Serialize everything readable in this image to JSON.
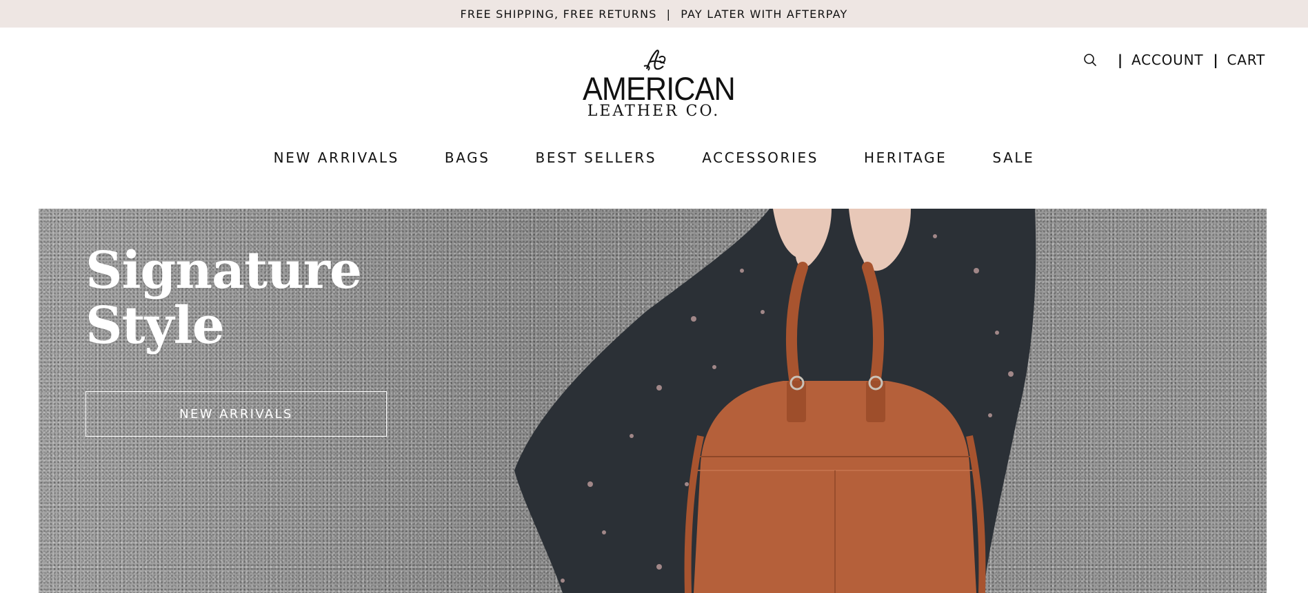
{
  "announcement": {
    "left_text": "FREE SHIPPING, FREE RETURNS",
    "separator": "|",
    "right_text": "PAY LATER WITH AFTERPAY"
  },
  "header": {
    "logo": {
      "monogram": "ALC",
      "line1": "AMERICAN",
      "line2": "LEATHER CO."
    },
    "utility": {
      "search_icon": "search-icon",
      "separator": "|",
      "account_label": "ACCOUNT",
      "cart_label": "CART"
    }
  },
  "nav": {
    "items": [
      {
        "label": "NEW ARRIVALS"
      },
      {
        "label": "BAGS"
      },
      {
        "label": "BEST SELLERS"
      },
      {
        "label": "ACCESSORIES"
      },
      {
        "label": "HERITAGE"
      },
      {
        "label": "SALE"
      }
    ]
  },
  "hero": {
    "headline_line1": "Signature",
    "headline_line2": "Style",
    "cta_label": "NEW ARRIVALS",
    "image": "woman-holding-leather-handbag"
  },
  "colors": {
    "announcement_bg": "#eee6e3",
    "text": "#111111",
    "hero_text": "#ffffff",
    "leather": "#b5603a"
  }
}
